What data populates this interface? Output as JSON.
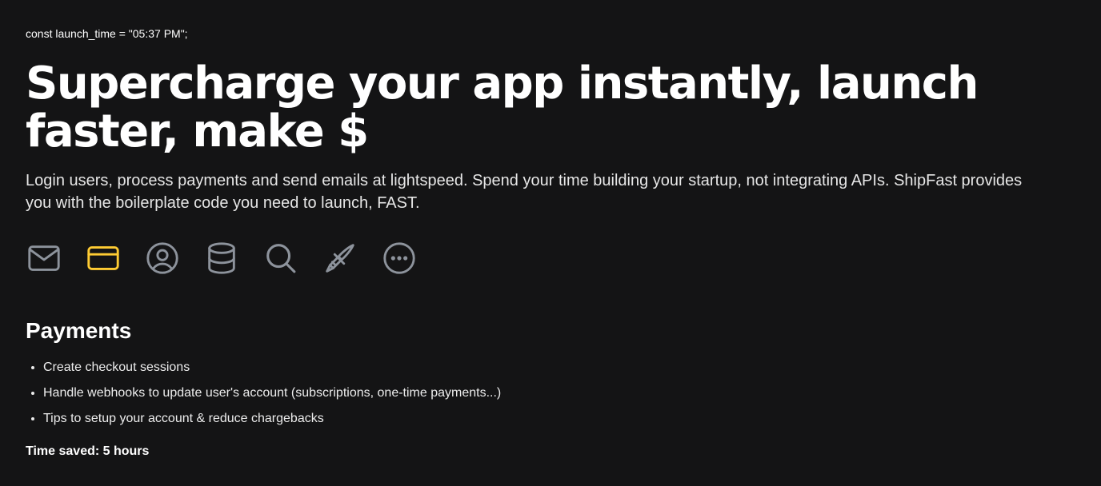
{
  "code_line": "const launch_time = \"05:37 PM\";",
  "hero": {
    "headline": "Supercharge your app instantly, launch faster, make $",
    "subtitle": "Login users, process payments and send emails at lightspeed. Spend your time building your startup, not integrating APIs. ShipFast provides you with the boilerplate code you need to launch, FAST."
  },
  "features": {
    "active_color": "#ffcc33",
    "inactive_color": "#8d939c",
    "items": [
      {
        "icon": "mail-icon",
        "active": false
      },
      {
        "icon": "credit-card-icon",
        "active": true
      },
      {
        "icon": "user-circle-icon",
        "active": false
      },
      {
        "icon": "database-icon",
        "active": false
      },
      {
        "icon": "search-icon",
        "active": false
      },
      {
        "icon": "paintbrush-icon",
        "active": false
      },
      {
        "icon": "more-icon",
        "active": false
      }
    ]
  },
  "section": {
    "title": "Payments",
    "bullets": [
      "Create checkout sessions",
      "Handle webhooks to update user's account (subscriptions, one-time payments...)",
      "Tips to setup your account & reduce chargebacks"
    ],
    "time_saved": "Time saved: 5 hours"
  }
}
